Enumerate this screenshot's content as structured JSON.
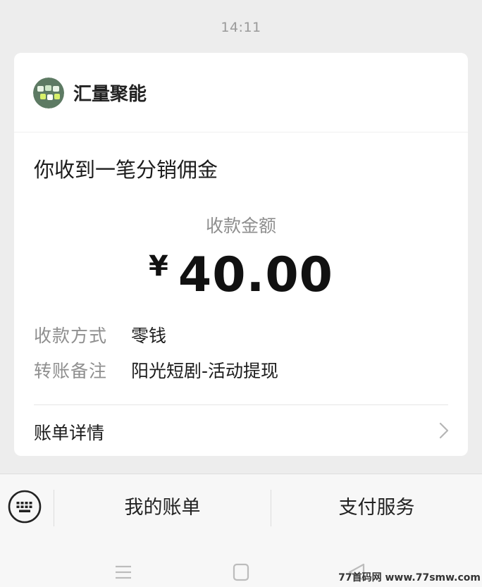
{
  "status_bar": {
    "time": "14:11"
  },
  "card": {
    "sender_name": "汇量聚能",
    "avatar_icon": "merchant-avatar-icon",
    "message_title": "你收到一笔分销佣金",
    "amount_label": "收款金额",
    "currency_symbol": "¥",
    "amount": "40.00",
    "rows": [
      {
        "label": "收款方式",
        "value": "零钱"
      },
      {
        "label": "转账备注",
        "value": "阳光短剧-活动提现"
      }
    ],
    "detail_label": "账单详情"
  },
  "bottom_menu": {
    "keyboard_icon": "keyboard-icon",
    "items": [
      {
        "label": "我的账单"
      },
      {
        "label": "支付服务"
      }
    ]
  },
  "watermark": "77首码网 www.77smw.com",
  "colors": {
    "background": "#ededed",
    "card": "#ffffff",
    "secondary_text": "#8f8f8f",
    "primary_text": "#1c1c1c"
  }
}
